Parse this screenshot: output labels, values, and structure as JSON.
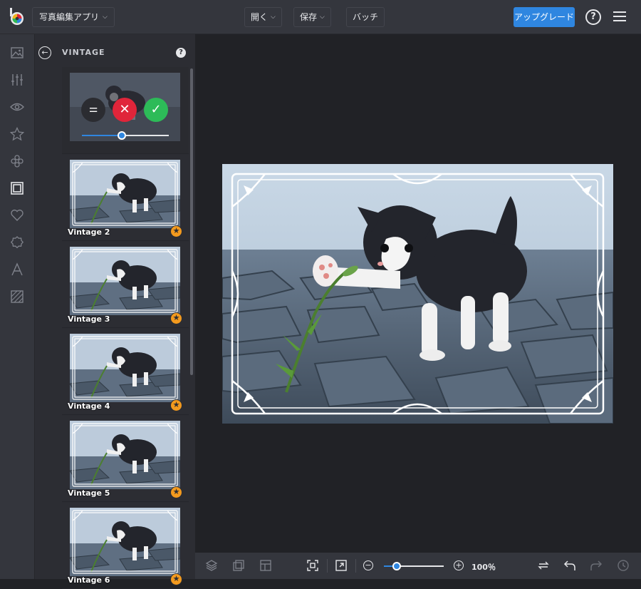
{
  "app": {
    "menu_label": "写真編集アプリ",
    "open_label": "開く",
    "save_label": "保存",
    "batch_label": "バッチ",
    "upgrade_label": "アップグレード",
    "help_label": "?"
  },
  "rail": {
    "items": [
      {
        "icon": "image-icon"
      },
      {
        "icon": "sliders-icon"
      },
      {
        "icon": "eye-icon"
      },
      {
        "icon": "star-icon"
      },
      {
        "icon": "effects-icon"
      },
      {
        "icon": "frame-icon",
        "active": true
      },
      {
        "icon": "heart-icon"
      },
      {
        "icon": "badge-icon"
      },
      {
        "icon": "text-icon"
      },
      {
        "icon": "texture-icon"
      }
    ]
  },
  "panel": {
    "title": "VINTAGE",
    "help": "?",
    "active_preview": {
      "slider_value": 0.45
    },
    "presets": [
      {
        "label": "Vintage 2",
        "premium": true
      },
      {
        "label": "Vintage 3",
        "premium": true
      },
      {
        "label": "Vintage 4",
        "premium": true
      },
      {
        "label": "Vintage 5",
        "premium": true
      },
      {
        "label": "Vintage 6",
        "premium": true
      }
    ]
  },
  "bottom_bar": {
    "zoom_value": "100％",
    "zoom_slider": 0.2,
    "zoom_minus": "−",
    "zoom_plus": "+"
  },
  "colors": {
    "accent": "#2f86e0",
    "cancel": "#e0253a",
    "apply": "#2dbb58",
    "premium": "#f39a1e"
  }
}
